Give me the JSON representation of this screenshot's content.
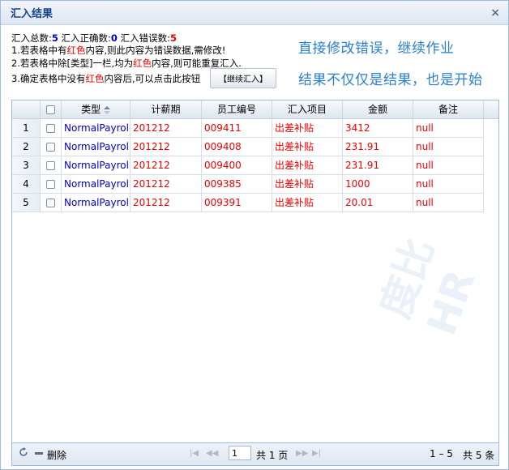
{
  "window": {
    "title": "汇入结果",
    "close_icon": "×"
  },
  "summary": {
    "total_label": "汇入总数:",
    "total_value": "5",
    "correct_label": "汇入正确数:",
    "correct_value": "0",
    "error_label": "汇入错误数:",
    "error_value": "5"
  },
  "notes": {
    "n1_a": "1.若表格中有",
    "n1_red": "红色",
    "n1_b": "内容,则此内容为错误数据,需修改!",
    "n2_a": "2.若表格中除[类型]一栏,均为",
    "n2_red": "红色",
    "n2_b": "内容,则可能重复汇入.",
    "n3_a": "3.确定表格中没有",
    "n3_red": "红色",
    "n3_b": "内容后,可以点击此按钮"
  },
  "continue_button": "【继续汇入】",
  "slogans": {
    "s1": "直接修改错误，继续作业",
    "s2": "结果不仅仅是结果，也是开始"
  },
  "watermark": "度比HR",
  "colors": {
    "header_blue": "#15428b",
    "error_red": "#ee0000",
    "type_blue": "#0000cc",
    "slogan_blue": "#2a7fd0"
  },
  "grid": {
    "columns": [
      "类型",
      "计薪期",
      "员工编号",
      "汇入项目",
      "金额",
      "备注"
    ],
    "sort_icon": "sort-arrows-icon",
    "rows": [
      {
        "num": "1",
        "type": "NormalPayrolls",
        "period": "201212",
        "emp": "009411",
        "item": "出差补贴",
        "amount": "3412",
        "remark": "null"
      },
      {
        "num": "2",
        "type": "NormalPayrolls",
        "period": "201212",
        "emp": "009408",
        "item": "出差补贴",
        "amount": "231.91",
        "remark": "null"
      },
      {
        "num": "3",
        "type": "NormalPayrolls",
        "period": "201212",
        "emp": "009400",
        "item": "出差补贴",
        "amount": "231.91",
        "remark": "null"
      },
      {
        "num": "4",
        "type": "NormalPayrolls",
        "period": "201212",
        "emp": "009385",
        "item": "出差补贴",
        "amount": "1000",
        "remark": "null"
      },
      {
        "num": "5",
        "type": "NormalPayrolls",
        "period": "201212",
        "emp": "009391",
        "item": "出差补贴",
        "amount": "20.01",
        "remark": "null"
      }
    ]
  },
  "pager": {
    "refresh_icon": "refresh-icon",
    "delete_label": "删除",
    "page_value": "1",
    "of_pages": "共 1 页",
    "range": "1 – 5",
    "total": "共 5 条"
  }
}
